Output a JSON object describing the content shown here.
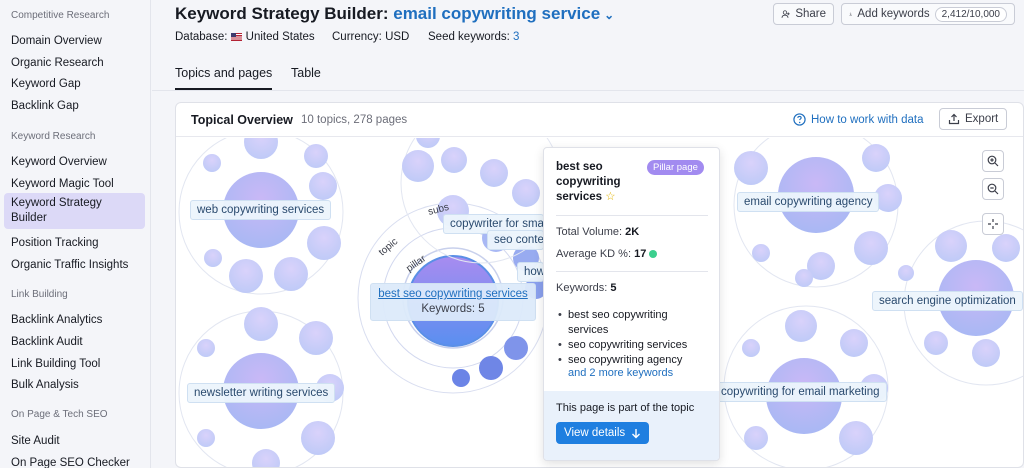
{
  "sidebar": {
    "sections": [
      {
        "title": "Competitive Research",
        "items": [
          "Domain Overview",
          "Organic Research",
          "Keyword Gap",
          "Backlink Gap"
        ]
      },
      {
        "title": "Keyword Research",
        "items": [
          "Keyword Overview",
          "Keyword Magic Tool",
          "Keyword Strategy Builder",
          "Position Tracking",
          "Organic Traffic Insights"
        ]
      },
      {
        "title": "Link Building",
        "items": [
          "Backlink Analytics",
          "Backlink Audit",
          "Link Building Tool",
          "Bulk Analysis"
        ]
      },
      {
        "title": "On Page & Tech SEO",
        "items": [
          "Site Audit",
          "On Page SEO Checker"
        ]
      }
    ],
    "active_item": "Keyword Strategy Builder"
  },
  "header": {
    "title_prefix": "Keyword Strategy Builder:",
    "title_accent": "email copywriting service",
    "database_label": "Database:",
    "database_value": "United States",
    "currency_label": "Currency:",
    "currency_value": "USD",
    "seed_label": "Seed keywords:",
    "seed_value": "3",
    "share_label": "Share",
    "add_keywords_label": "Add keywords",
    "keyword_count": "2,412/10,000"
  },
  "tabs": [
    {
      "label": "Topics and pages",
      "active": true
    },
    {
      "label": "Table",
      "active": false
    }
  ],
  "overview": {
    "title": "Topical Overview",
    "subtitle": "10 topics, 278 pages",
    "how_label": "How to work with data",
    "export_label": "Export"
  },
  "clusters": [
    {
      "label": "web copywriting services"
    },
    {
      "label": "newsletter writing services"
    },
    {
      "label": "email copywriting agency"
    },
    {
      "label": "search engine optimization"
    },
    {
      "label": "copywriting for email marketing"
    },
    {
      "label": "copywriter for sma"
    },
    {
      "label": "seo conte"
    },
    {
      "label": "how"
    }
  ],
  "focus_cluster": {
    "label": "best seo copywriting services",
    "keywords_text": "Keywords: 5",
    "ring_labels": [
      "topic",
      "subs",
      "pillar"
    ]
  },
  "tooltip": {
    "keyword": "best seo copywriting services",
    "badge": "Pillar page",
    "total_volume_label": "Total Volume:",
    "total_volume_value": "2K",
    "kd_label": "Average KD %:",
    "kd_value": "17",
    "keywords_label": "Keywords:",
    "keywords_value": "5",
    "keywords": [
      "best seo copywriting services",
      "seo copywriting services",
      "seo copywriting agency"
    ],
    "more_link": "and 2 more keywords",
    "foot_text": "This page is part of the topic",
    "view_details": "View details"
  },
  "colors": {
    "accent": "#1f6fbf",
    "active_sidebar": "#dcd9f7",
    "pillar_badge": "#a28bf0",
    "kd_green": "#3ccf8e",
    "button_blue": "#1f7fe0"
  }
}
